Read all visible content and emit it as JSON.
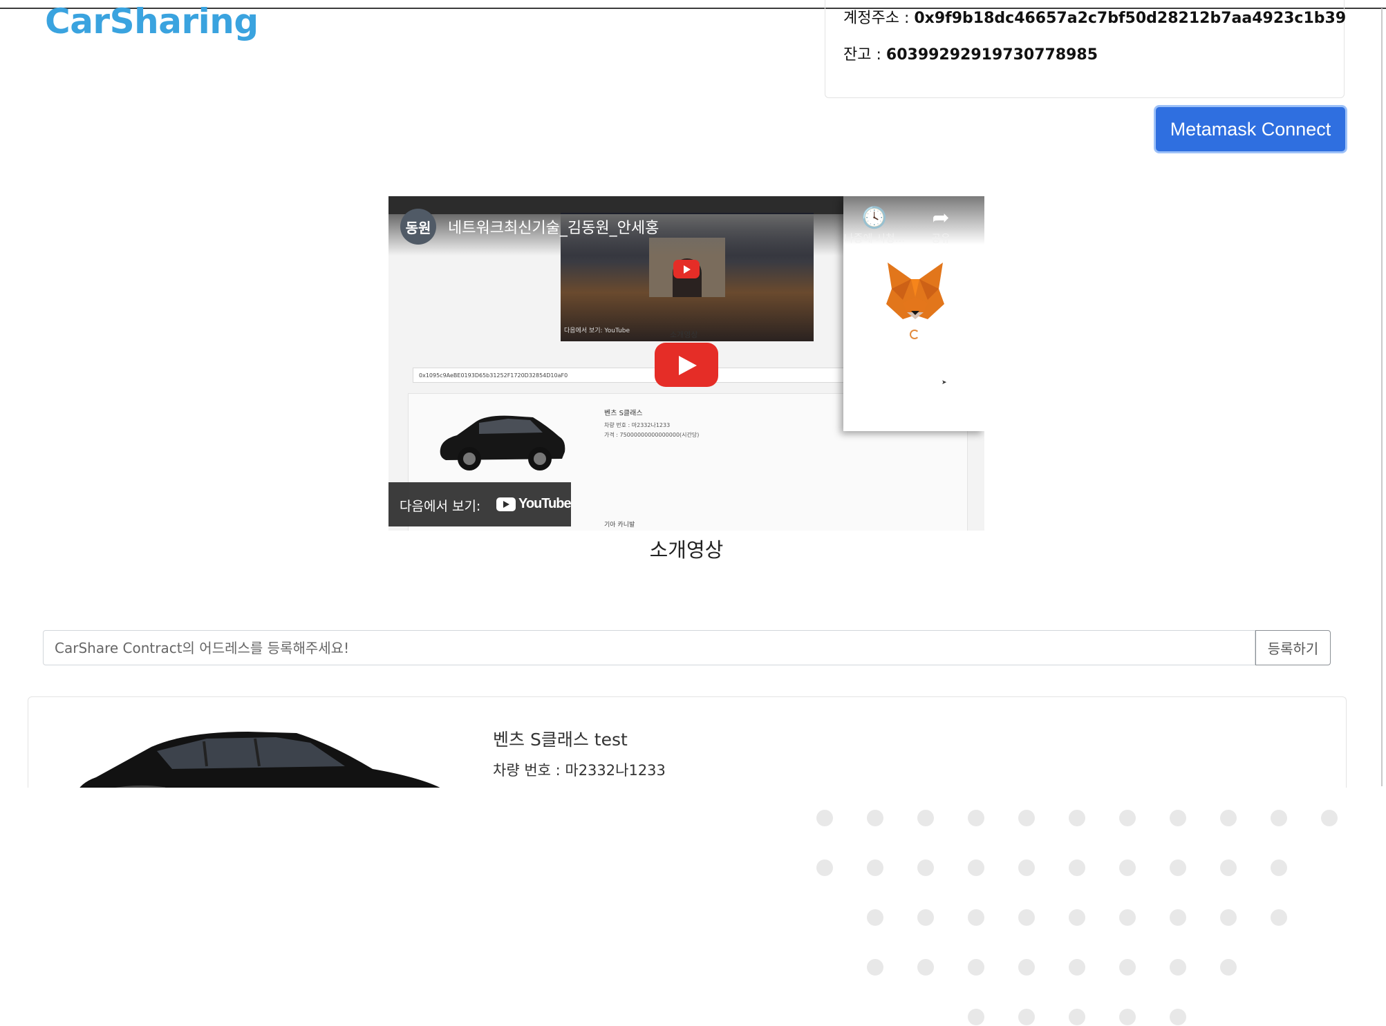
{
  "header": {
    "logo": "CarSharing"
  },
  "account": {
    "address_label": "계정주소 : ",
    "address_value": "0x9f9b18dc46657a2c7bf50d28212b7aa4923c1b39",
    "balance_label": "잔고 : ",
    "balance_value": "60399292919730778985"
  },
  "metamask": {
    "button_label": "Metamask Connect"
  },
  "video": {
    "channel_avatar": "동원",
    "title": "네트워크최신기술_김동원_안세홍",
    "watch_later": "나중에 시청...",
    "share": "공유",
    "watch_on": "다음에서 보기:",
    "youtube": "YouTube",
    "inner_caption": "소개영상",
    "inner_address": "0x1095c9AeBE0193D65b31252F1720D32854D10aF0",
    "inner_car_title": "벤츠 S클래스",
    "inner_car_plate": "차량 번호 : 마2332나1233",
    "inner_car_price": "가격 : 75000000000000000(시간당)",
    "inner_car2_title": "기아 카니발",
    "inner_thumb_label": "다음에서 보기:  YouTube"
  },
  "video_caption": "소개영상",
  "register": {
    "placeholder": "CarShare Contract의 어드레스를 등록해주세요!",
    "button_label": "등록하기"
  },
  "car": {
    "title": "벤츠 S클래스 test",
    "plate": "차량 번호 : 마2332나1233"
  },
  "colors": {
    "logo": "#3aa3df",
    "primary_button": "#2f6fe0",
    "youtube_red": "#e52d27"
  }
}
